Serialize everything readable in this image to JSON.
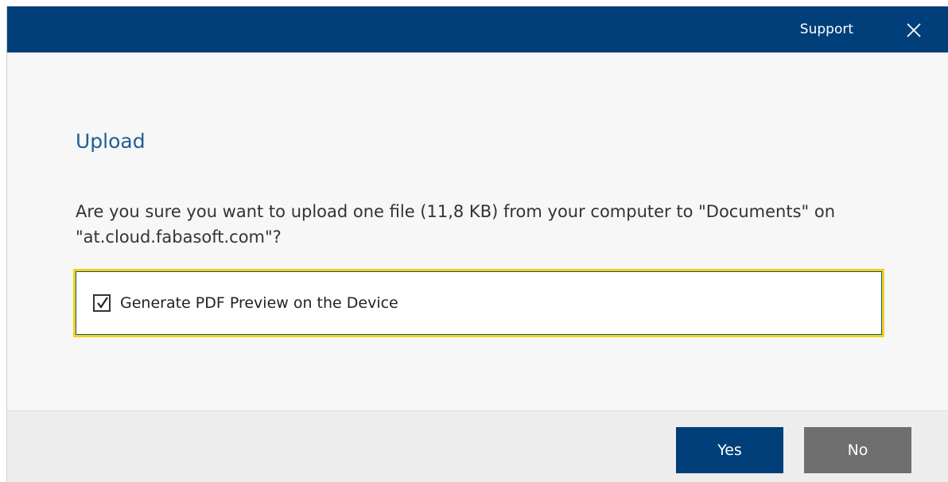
{
  "header": {
    "support_label": "Support",
    "close_icon": "close-icon"
  },
  "dialog": {
    "title": "Upload",
    "message": "Are you sure you want to upload one file (11,8 KB) from your computer to \"Documents\" on \"at.cloud.fabasoft.com\"?",
    "option": {
      "label": "Generate PDF Preview on the Device",
      "checked": true,
      "check_icon": "checkmark-icon"
    }
  },
  "footer": {
    "yes_label": "Yes",
    "no_label": "No"
  },
  "colors": {
    "header_bg": "#003f7a",
    "title_text": "#1f5d97",
    "yes_button": "#003f7a",
    "no_button": "#6f6f6f",
    "focus_border": "#f2d21a"
  }
}
